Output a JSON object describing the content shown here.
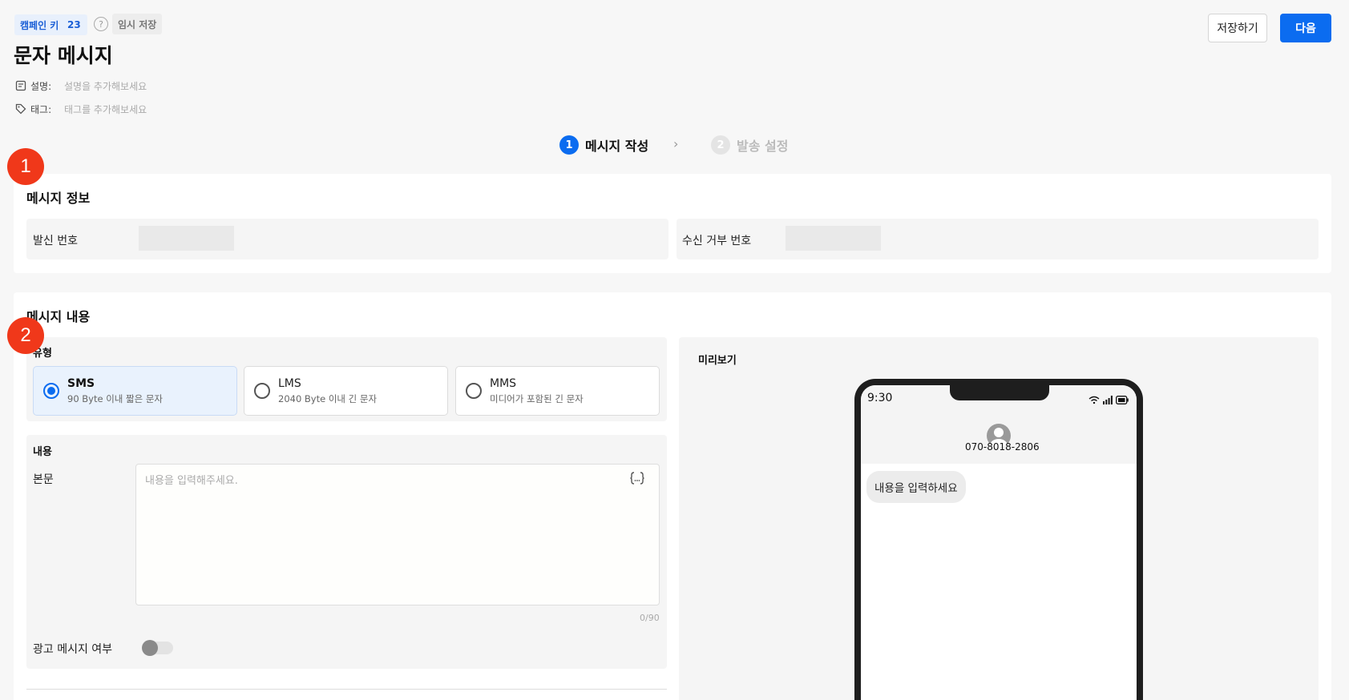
{
  "header": {
    "campaign_key_label": "캠페인 키",
    "campaign_key_value": "23",
    "help_glyph": "?",
    "draft_badge": "임시 저장",
    "title": "문자 메시지",
    "description_label": "설명:",
    "description_placeholder": "설명을 추가해보세요",
    "tag_label": "태그:",
    "tag_placeholder": "태그를 추가해보세요",
    "save_button": "저장하기",
    "next_button": "다음"
  },
  "stepper": {
    "steps": [
      {
        "num": "1",
        "label": "메시지 작성",
        "active": true
      },
      {
        "num": "2",
        "label": "발송 설정",
        "active": false
      }
    ],
    "chevron": "›"
  },
  "markers": [
    "1",
    "2"
  ],
  "message_info": {
    "title": "메시지 정보",
    "sender_label": "발신 번호",
    "reject_label": "수신 거부 번호"
  },
  "message_content": {
    "title": "메시지 내용",
    "type_label": "유형",
    "types": [
      {
        "name": "SMS",
        "desc": "90 Byte 이내 짧은 문자",
        "selected": true
      },
      {
        "name": "LMS",
        "desc": "2040 Byte 이내 긴 문자",
        "selected": false
      },
      {
        "name": "MMS",
        "desc": "미디어가 포함된 긴 문자",
        "selected": false
      }
    ],
    "content_label": "내용",
    "body_label": "본문",
    "body_placeholder": "내용을 입력해주세요.",
    "byte_counter": "0/90",
    "ad_label": "광고 메시지 여부",
    "ad_enabled": false
  },
  "preview": {
    "title": "미리보기",
    "time": "9:30",
    "phone_number": "070-8018-2806",
    "bubble_text": "내용을 입력하세요"
  },
  "colors": {
    "primary": "#0b6cf0",
    "marker": "#f0381a",
    "background": "#f7f7f7"
  },
  "icons": [
    "help-icon",
    "note-icon",
    "tag-icon",
    "variable-icon",
    "wifi-icon",
    "signal-icon",
    "battery-icon",
    "avatar-icon"
  ]
}
